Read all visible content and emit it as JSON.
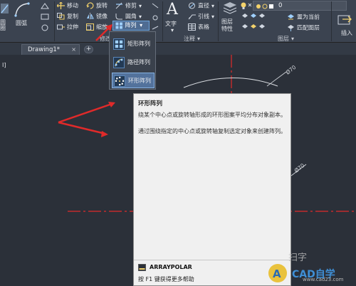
{
  "ribbon": {
    "modify": {
      "move": "移动",
      "rotate": "旋转",
      "trim": "修剪",
      "copy": "复制",
      "mirror": "镜像",
      "fillet": "圆角",
      "stretch": "拉伸",
      "scale": "缩放",
      "array": "阵列",
      "panel_label": "修改"
    },
    "left_fragments": {
      "circle_label": "圆弧",
      "shape_label": "圆",
      "panel_icon_char": "圈"
    },
    "annotation": {
      "text": "文字",
      "dimension": "直径",
      "leader": "引线",
      "table": "表格",
      "panel_label": "注释"
    },
    "layers": {
      "properties_line1": "图层",
      "properties_line2": "特性",
      "layer_value": "0",
      "set_current": "置为当前",
      "match_layer": "匹配图层",
      "panel_label": "图层"
    },
    "insert_label": "插入",
    "colors": {
      "ribbon_bg": "#3b4350",
      "highlight": "#4f6c92",
      "highlight_border": "#6ea6df"
    }
  },
  "tabs": {
    "active_label": "Drawing1*",
    "close_glyph": "×",
    "new_tab_glyph": "+"
  },
  "array_dropdown": {
    "items": [
      {
        "label": "矩形阵列",
        "icon": "rectangular-array-icon"
      },
      {
        "label": "路径阵列",
        "icon": "path-array-icon"
      },
      {
        "label": "环形阵列",
        "icon": "polar-array-icon",
        "active": true
      }
    ]
  },
  "canvas": {
    "dim_labels": [
      "Ø70",
      "Ø70"
    ],
    "left_marker": "I]",
    "colors": {
      "background": "#2b3039",
      "centerline": "#e02a2a",
      "arrow": "#e02a2a"
    }
  },
  "tooltip": {
    "title": "环形阵列",
    "description1": "绕某个中心点或旋转轴形成的环形图案平均分布对象副本。",
    "description2": "通过围绕指定的中心点或旋转轴复制选定对象来创建阵列。",
    "command": "ARRAYPOLAR",
    "help": "按 F1 键获得更多帮助"
  },
  "watermark": {
    "text": "扫字",
    "domain": "www.cad23.com",
    "brand": "CAD自学"
  }
}
